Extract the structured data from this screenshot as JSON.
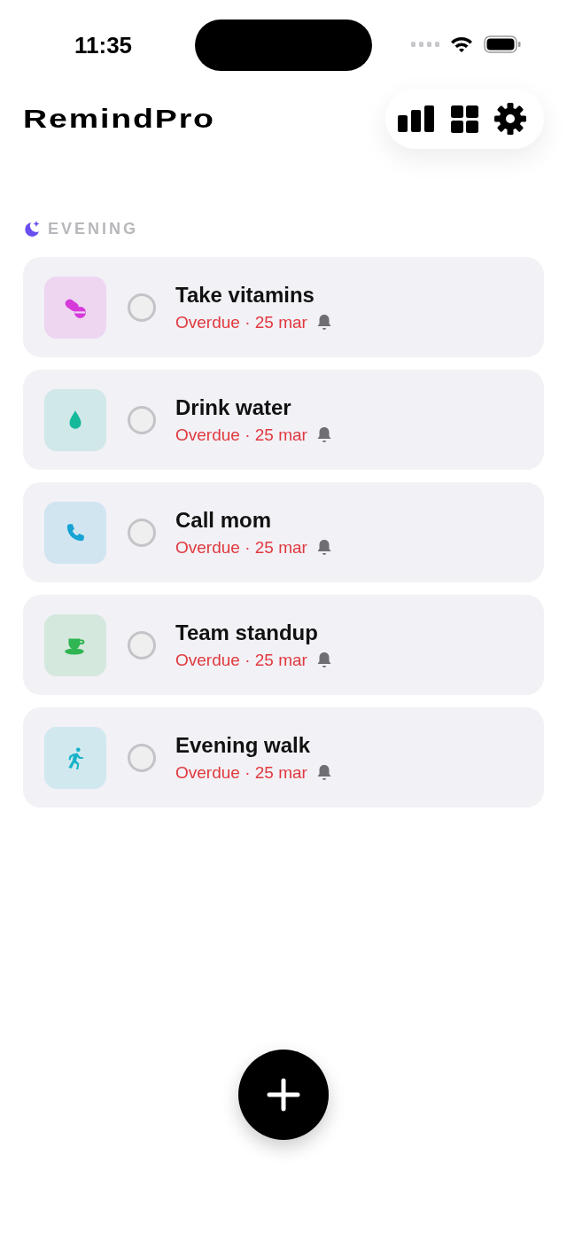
{
  "status_bar": {
    "time": "11:35"
  },
  "header": {
    "title": "RemindPro"
  },
  "section": {
    "label": "EVENING"
  },
  "reminders": [
    {
      "title": "Take vitamins",
      "subtitle": "Overdue · 25 mar",
      "kind": "pill",
      "color": "#d63ad9",
      "done": false
    },
    {
      "title": "Drink water",
      "subtitle": "Overdue · 25 mar",
      "kind": "drop",
      "color": "#14b89a",
      "done": false
    },
    {
      "title": "Call mom",
      "subtitle": "Overdue · 25 mar",
      "kind": "phone",
      "color": "#16a3d4",
      "done": false
    },
    {
      "title": "Team standup",
      "subtitle": "Overdue · 25 mar",
      "kind": "cup",
      "color": "#2fb552",
      "done": false
    },
    {
      "title": "Evening walk",
      "subtitle": "Overdue · 25 mar",
      "kind": "runner",
      "color": "#17b3c9",
      "done": false
    }
  ]
}
